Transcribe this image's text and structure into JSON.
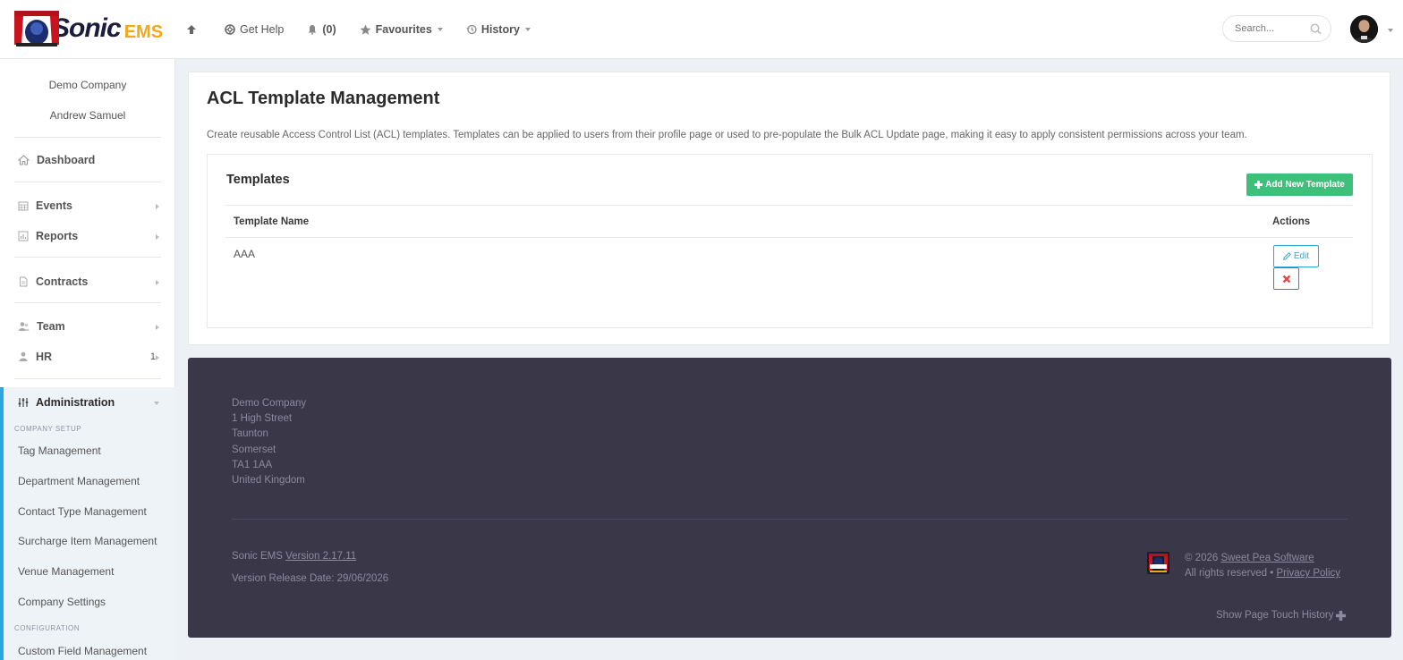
{
  "header": {
    "brand": "Sonic",
    "brand_suffix": "EMS",
    "nav": {
      "get_help": "Get Help",
      "notifications": "(0)",
      "favourites": "Favourites",
      "history": "History"
    },
    "search_placeholder": "Search..."
  },
  "sidebar": {
    "company": "Demo Company",
    "user": "Andrew Samuel",
    "items": [
      {
        "label": "Dashboard",
        "icon": "home-icon"
      },
      {
        "label": "Events",
        "icon": "calendar-icon"
      },
      {
        "label": "Reports",
        "icon": "chart-icon"
      },
      {
        "label": "Contracts",
        "icon": "document-icon"
      },
      {
        "label": "Team",
        "icon": "team-icon"
      },
      {
        "label": "HR",
        "icon": "person-icon",
        "badge": "1"
      },
      {
        "label": "Administration",
        "icon": "sliders-icon"
      }
    ],
    "sections": {
      "company_setup": "COMPANY SETUP",
      "configuration": "CONFIGURATION"
    },
    "admin_links": [
      "Tag Management",
      "Department Management",
      "Contact Type Management",
      "Surcharge Item Management",
      "Venue Management",
      "Company Settings"
    ],
    "config_links": [
      "Custom Field Management"
    ]
  },
  "main": {
    "title": "ACL Template Management",
    "description": "Create reusable Access Control List (ACL) templates. Templates can be applied to users from their profile page or used to pre-populate the Bulk ACL Update page, making it easy to apply consistent permissions across your team.",
    "templates_title": "Templates",
    "add_button": "Add New Template",
    "table": {
      "headers": [
        "Template Name",
        "Actions"
      ],
      "rows": [
        {
          "name": "AAA"
        }
      ],
      "edit_label": "Edit"
    }
  },
  "footer": {
    "address": [
      "Demo Company",
      "1 High Street",
      "Taunton",
      "Somerset",
      "TA1 1AA",
      "United Kingdom"
    ],
    "product": "Sonic EMS",
    "version_link": "Version 2.17.11",
    "release_date": "Version Release Date: 29/06/2026",
    "copyright": "© 2026",
    "company_link": "Sweet Pea Software",
    "rights": "All rights reserved •",
    "privacy_link": "Privacy Policy",
    "touch_history": "Show Page Touch History"
  },
  "colors": {
    "accent": "#2aa7e0",
    "success": "#3ec07a",
    "danger": "#e04848",
    "footer_bg": "#3a3749",
    "brand_orange": "#f0a81d"
  }
}
